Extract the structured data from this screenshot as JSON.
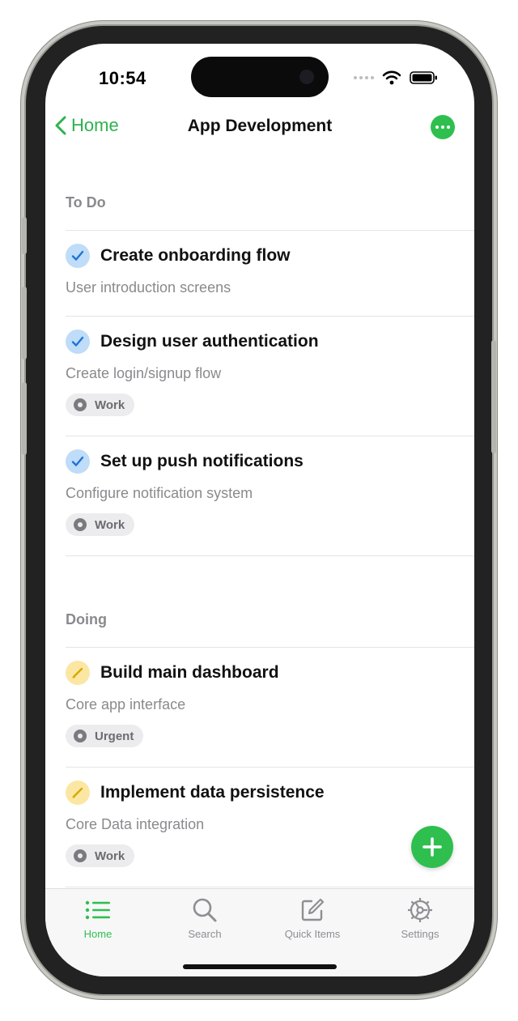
{
  "status_bar": {
    "time": "10:54"
  },
  "nav": {
    "back_label": "Home",
    "title": "App Development"
  },
  "colors": {
    "accent": "#2fbf4f",
    "todo_badge": "#bfdcf8",
    "doing_badge": "#fbe7a3"
  },
  "sections": [
    {
      "header": "To Do",
      "status_icon": "checkmark-icon",
      "tasks": [
        {
          "title": "Create onboarding flow",
          "subtitle": "User introduction screens",
          "tag": null
        },
        {
          "title": "Design user authentication",
          "subtitle": "Create login/signup flow",
          "tag": "Work"
        },
        {
          "title": "Set up push notifications",
          "subtitle": "Configure notification system",
          "tag": "Work"
        }
      ]
    },
    {
      "header": "Doing",
      "status_icon": "pencil-icon",
      "tasks": [
        {
          "title": "Build main dashboard",
          "subtitle": "Core app interface",
          "tag": "Urgent"
        },
        {
          "title": "Implement data persistence",
          "subtitle": "Core Data integration",
          "tag": "Work"
        }
      ]
    }
  ],
  "tab_bar": {
    "active": "Home",
    "items": [
      {
        "label": "Home",
        "icon": "list-icon"
      },
      {
        "label": "Search",
        "icon": "magnifier-icon"
      },
      {
        "label": "Quick Items",
        "icon": "compose-icon"
      },
      {
        "label": "Settings",
        "icon": "gear-icon"
      }
    ]
  }
}
